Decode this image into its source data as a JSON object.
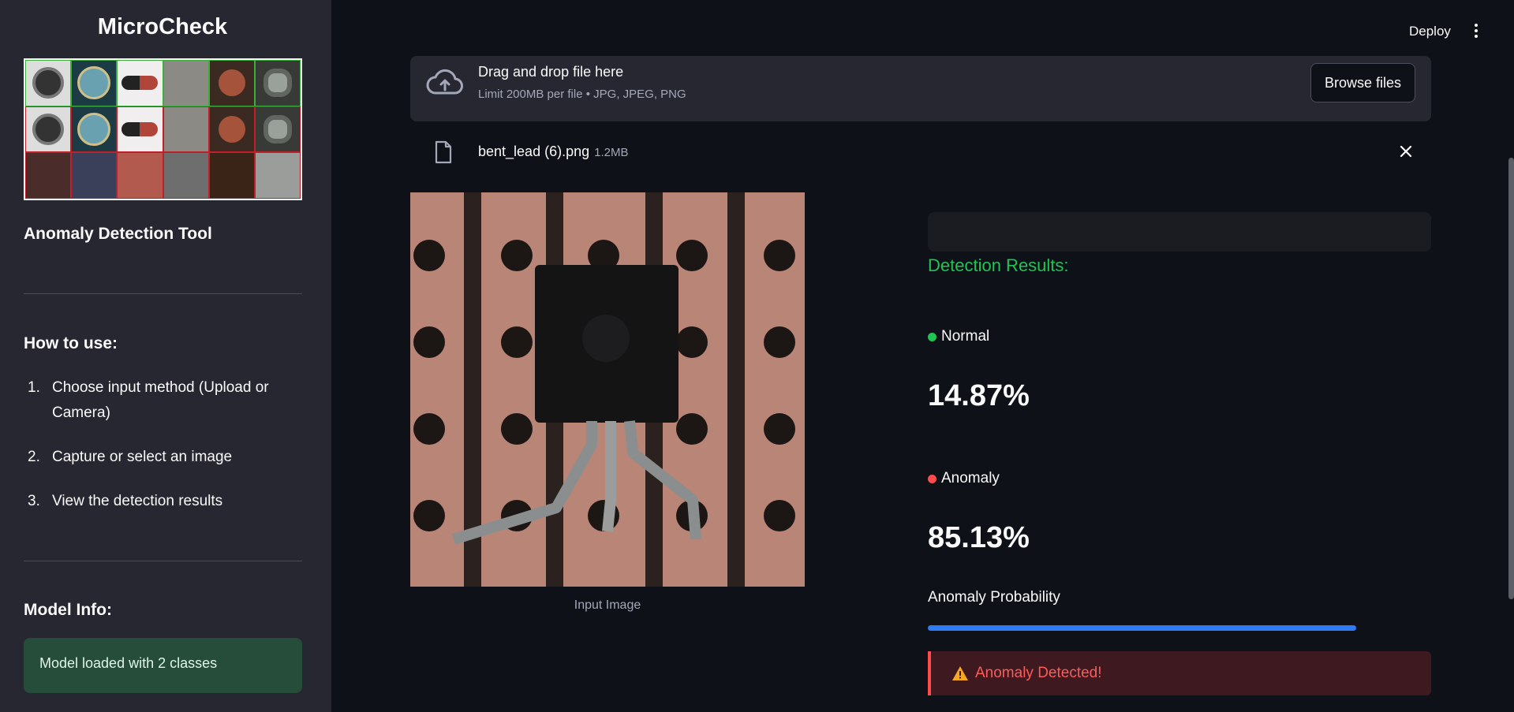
{
  "sidebar": {
    "app_title": "MicroCheck",
    "subtitle": "Anomaly Detection Tool",
    "howto_title": "How to use:",
    "steps": [
      {
        "num": "1.",
        "text": "Choose input method (Upload or Camera)"
      },
      {
        "num": "2.",
        "text": "Capture or select an image"
      },
      {
        "num": "3.",
        "text": "View the detection results"
      }
    ],
    "model_title": "Model Info:",
    "model_status": "Model loaded with 2 classes"
  },
  "header": {
    "deploy_label": "Deploy",
    "menu_icon": "kebab-menu-icon"
  },
  "uploader": {
    "drop_title": "Drag and drop file here",
    "limit_text": "Limit 200MB per file • JPG, JPEG, PNG",
    "browse_label": "Browse files",
    "file_name": "bent_lead (6).png",
    "file_size": "1.2MB"
  },
  "image": {
    "caption": "Input Image"
  },
  "results": {
    "title": "Detection Results:",
    "normal_label": "Normal",
    "normal_value": "14.87%",
    "anomaly_label": "Anomaly",
    "anomaly_value": "85.13%",
    "prob_label": "Anomaly Probability",
    "prob_fraction": 0.8513,
    "alert_text": "Anomaly Detected!"
  },
  "colors": {
    "accent_green": "#21c354",
    "normal_dot": "#21c354",
    "anomaly_dot": "#ff4b4b",
    "progress": "#2f7bf6",
    "alert_bg": "#3e1a20"
  }
}
